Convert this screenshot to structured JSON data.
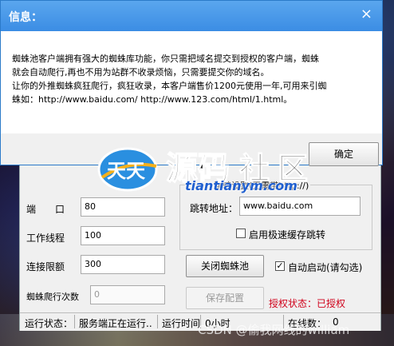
{
  "dialog": {
    "title": "信息：",
    "close_glyph": "×",
    "message_lines": [
      "蜘蛛池客户端拥有强大的蜘蛛库功能，你只需把域名提交到授权的客户端，蜘蛛",
      "就会自动爬行,再也不用为站群不收录烦恼，只需要提交你的域名。",
      "让你的外推蜘蛛疯狂爬行，疯狂收录，本客户端售价1200元使用一年,可用来引蜘",
      "蛛如：http://www.baidu.com/   http://www.123.com/html/1.html。"
    ],
    "ok_label": "确定"
  },
  "form": {
    "port_label": "端　　口",
    "port_value": "80",
    "threads_label": "工作线程",
    "threads_value": "100",
    "limit_label": "连接限额",
    "limit_value": "300",
    "crawl_label": "蜘蛛爬行次数",
    "crawl_value": "0",
    "jump_group_title": "跳转设置(无需带http://)",
    "jump_label": "跳转地址：",
    "jump_value": "www.baidu.com",
    "fast_cache_label": "启用极速缓存跳转",
    "fast_cache_checked": false,
    "close_pool_label": "关闭蜘蛛池",
    "auto_start_label": "自动启动(请勾选)",
    "auto_start_checked": true,
    "save_label": "保存配置",
    "auth_status": "授权状态：已授权",
    "auth_color": "#d0021b"
  },
  "statusbar": {
    "state_label": "运行状态：",
    "state_value": "服务端正在运行..",
    "runtime_label": "运行时间",
    "runtime_value": "0小时",
    "online_label": "在线数：",
    "online_value": "0"
  },
  "watermark": {
    "logo_text_1": "天天",
    "logo_text_2": "源码",
    "logo_text_3": "社区",
    "url": "tiantianym.com",
    "csdn": "CSDN @偷我网线的william"
  }
}
